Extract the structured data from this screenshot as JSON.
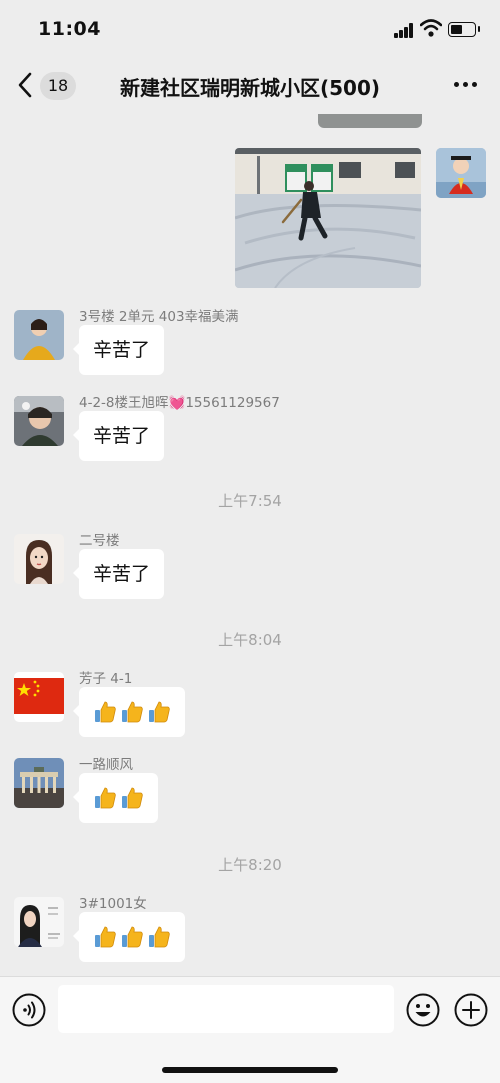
{
  "status_bar": {
    "time": "11:04"
  },
  "nav": {
    "unread_count": "18",
    "title": "新建社区瑞明新城小区(500)"
  },
  "messages": [
    {
      "sender": "3号楼 2单元 403幸福美满",
      "text": "辛苦了"
    },
    {
      "sender": "4-2-8楼王旭晖💓15561129567",
      "text": "辛苦了"
    },
    {
      "timestamp": "上午7:54"
    },
    {
      "sender": "二号楼",
      "text": "辛苦了"
    },
    {
      "timestamp": "上午8:04"
    },
    {
      "sender": "芳子 4-1",
      "thumbs_up": 3
    },
    {
      "sender": "一路顺风",
      "thumbs_up": 2
    },
    {
      "timestamp": "上午8:20"
    },
    {
      "sender": "3#1001女",
      "thumbs_up": 3
    }
  ],
  "input_bar": {
    "placeholder": ""
  },
  "colors": {
    "background": "#ededed",
    "bubble": "#ffffff",
    "thumb": "#f5b41c",
    "flag": "#de2910"
  }
}
